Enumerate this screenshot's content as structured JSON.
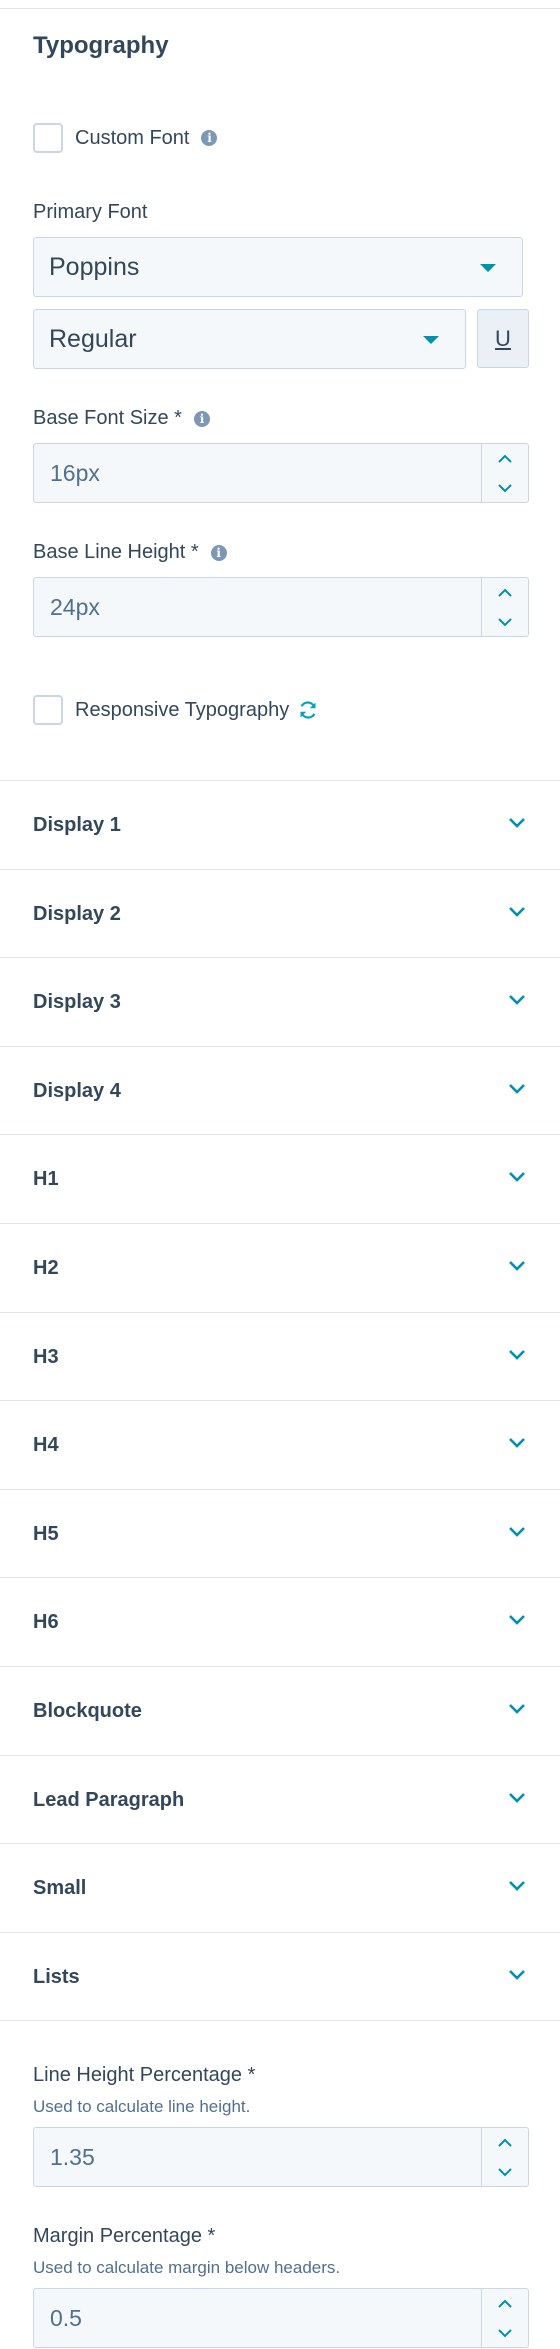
{
  "section": {
    "title": "Typography"
  },
  "custom_font": {
    "label": "Custom Font",
    "checked": false
  },
  "primary_font": {
    "label": "Primary Font",
    "family": "Poppins",
    "weight": "Regular",
    "underline_label": "U"
  },
  "base_font_size": {
    "label": "Base Font Size *",
    "value": "16px"
  },
  "base_line_height": {
    "label": "Base Line Height *",
    "value": "24px"
  },
  "responsive": {
    "label": "Responsive Typography",
    "checked": false
  },
  "accordions": [
    {
      "label": "Display 1"
    },
    {
      "label": "Display 2"
    },
    {
      "label": "Display 3"
    },
    {
      "label": "Display 4"
    },
    {
      "label": "H1"
    },
    {
      "label": "H2"
    },
    {
      "label": "H3"
    },
    {
      "label": "H4"
    },
    {
      "label": "H5"
    },
    {
      "label": "H6"
    },
    {
      "label": "Blockquote"
    },
    {
      "label": "Lead Paragraph"
    },
    {
      "label": "Small"
    },
    {
      "label": "Lists"
    }
  ],
  "line_height_pct": {
    "label": "Line Height Percentage *",
    "help": "Used to calculate line height.",
    "value": "1.35"
  },
  "margin_pct": {
    "label": "Margin Percentage *",
    "help": "Used to calculate margin below headers.",
    "value": "0.5"
  },
  "colors": {
    "accent": "#0091ae",
    "text": "#33475b",
    "border": "#cbd6e2",
    "input_bg": "#f5f8fa"
  }
}
